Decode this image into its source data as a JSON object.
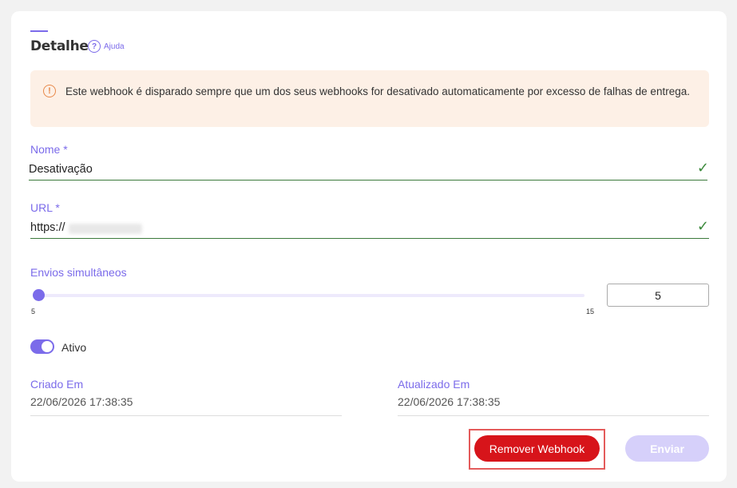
{
  "header": {
    "title": "Detalhe",
    "help_label": "Ajuda"
  },
  "alert": {
    "text": "Este webhook é disparado sempre que um dos seus webhooks for desativado automaticamente por excesso de falhas de entrega."
  },
  "form": {
    "name_label": "Nome *",
    "name_value": "Desativação",
    "url_label": "URL *",
    "url_value": "https://",
    "concurrency_label": "Envios simultâneos",
    "concurrency_min": "5",
    "concurrency_max": "15",
    "concurrency_value": "5",
    "active_label": "Ativo",
    "active": true
  },
  "meta": {
    "created_label": "Criado Em",
    "created_value": "22/06/2026 17:38:35",
    "updated_label": "Atualizado Em",
    "updated_value": "22/06/2026 17:38:35"
  },
  "actions": {
    "remove_label": "Remover Webhook",
    "send_label": "Enviar"
  },
  "colors": {
    "accent": "#7b6bea",
    "danger": "#d7141a",
    "success": "#3c8a3c",
    "alert_bg": "#fdf0e6"
  }
}
